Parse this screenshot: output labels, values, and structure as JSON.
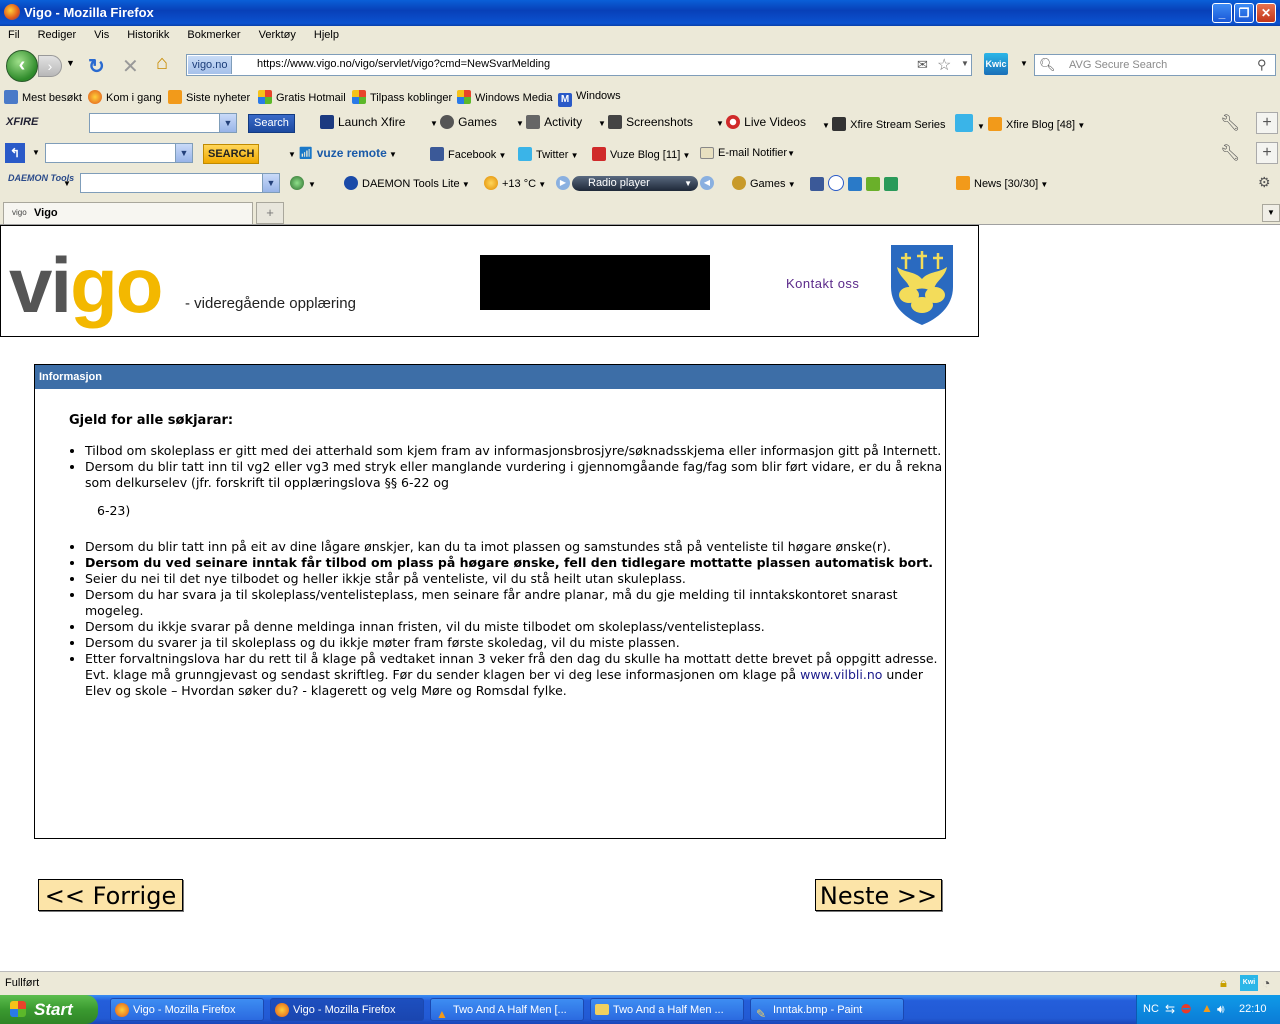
{
  "window": {
    "title": "Vigo - Mozilla Firefox"
  },
  "menu": [
    "Fil",
    "Rediger",
    "Vis",
    "Historikk",
    "Bokmerker",
    "Verktøy",
    "Hjelp"
  ],
  "nav": {
    "site_label": "vigo.no",
    "url": "https://www.vigo.no/vigo/servlet/vigo?cmd=NewSvarMelding",
    "kwic": "Kwic",
    "search_placeholder": "AVG Secure Search"
  },
  "bookmarks": [
    "Mest besøkt",
    "Kom i gang",
    "Siste nyheter",
    "Gratis Hotmail",
    "Tilpass koblinger",
    "Windows Media",
    "Windows"
  ],
  "xfire_toolbar": {
    "logo": "XFIRE",
    "search": "Search",
    "items": [
      "Launch Xfire",
      "Games",
      "Activity",
      "Screenshots",
      "Live Videos",
      "Xfire Stream Series",
      "Xfire Blog [48]"
    ]
  },
  "vuze_toolbar": {
    "search": "SEARCH",
    "items": [
      "vuze remote",
      "Facebook",
      "Twitter",
      "Vuze Blog [11]",
      "E-mail Notifier"
    ]
  },
  "daemon_toolbar": {
    "logo": "DAEMON Tools",
    "items": [
      "DAEMON Tools Lite",
      "+13 °C",
      "Radio player",
      "Games",
      "News [30/30]"
    ]
  },
  "tab": {
    "label": "Vigo"
  },
  "header": {
    "logo_a": "vi",
    "logo_b": "go",
    "tagline": "- videregående opplæring",
    "contact": "Kontakt oss"
  },
  "info": {
    "heading": "Informasjon",
    "subheading": "Gjeld for alle søkjarar:",
    "items": [
      "Tilbod om skoleplass er gitt med dei atterhald som kjem fram av informasjonsbrosjyre/søknadsskjema eller informasjon gitt på Internett.",
      "Dersom du blir tatt inn til vg2 eller vg3 med stryk eller manglande vurdering i gjennomgåande fag/fag som blir ført vidare, er du å rekna som delkurselev (jfr. forskrift til opplæringslova §§ 6-22 og",
      "6-23)",
      "Dersom du blir tatt inn på eit av dine lågare ønskjer, kan du ta imot plassen og samstundes stå på venteliste til høgare ønske(r).",
      "Dersom du ved seinare inntak får tilbod om plass på høgare ønske, fell den tidlegare mottatte plassen automatisk bort.",
      "Seier du nei til det nye tilbodet og heller ikkje står på venteliste, vil du stå heilt utan skuleplass.",
      "Dersom du har svara ja til skoleplass/ventelisteplass, men seinare får andre planar, må du gje melding til inntakskontoret snarast mogeleg.",
      "Dersom du ikkje svarar på denne meldinga innan fristen, vil du miste tilbodet om skoleplass/ventelisteplass.",
      "Dersom du svarer ja til skoleplass og du ikkje møter fram første skoledag, vil du miste plassen.",
      "Etter forvaltningslova har du rett til å klage på vedtaket innan 3 veker frå den dag du skulle ha mottatt dette brevet på oppgitt adresse. Evt. klage må grunngjevast og sendast skriftleg. Før du sender klagen ber vi deg lese informasjonen om klage på"
    ],
    "link": "www.vilbli.no",
    "last_tail": " under Elev og skole – Hvordan søker du? - klagerett og velg Møre og Romsdal fylke."
  },
  "buttons": {
    "prev": "<< Forrige",
    "next": "Neste >>"
  },
  "status": {
    "text": "Fullført"
  },
  "taskbar": {
    "start": "Start",
    "tasks": [
      "Vigo - Mozilla Firefox",
      "Vigo - Mozilla Firefox",
      "Two And A Half Men [...",
      "Two And a Half Men ...",
      "Inntak.bmp - Paint"
    ],
    "lang": "NC",
    "clock": "22:10"
  }
}
